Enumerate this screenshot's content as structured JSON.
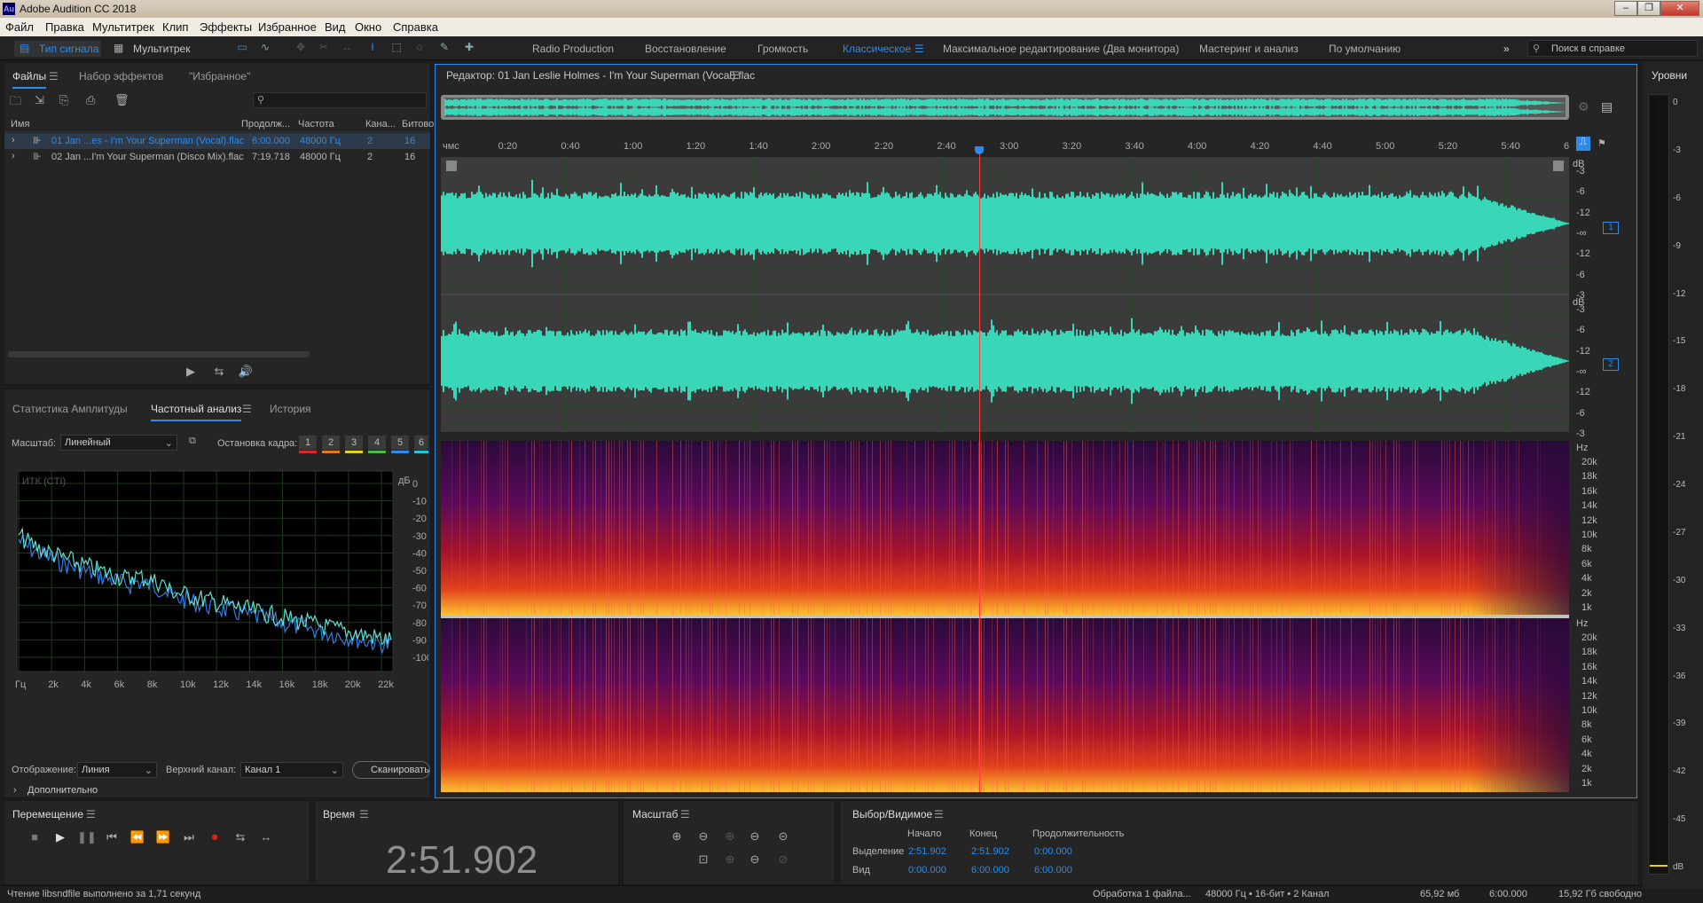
{
  "title": "Adobe Audition CC 2018",
  "app_icon": "Au",
  "window_controls": [
    "minimize-icon",
    "restore-icon",
    "close-icon"
  ],
  "menu": [
    "Файл",
    "Правка",
    "Мультитрек",
    "Клип",
    "Эффекты",
    "Избранное",
    "Вид",
    "Окно",
    "Справка"
  ],
  "views": {
    "waveform": "Тип сигнала",
    "multitrack": "Мультитрек"
  },
  "workspaces": [
    "Radio Production",
    "Восстановление",
    "Громкость",
    "Классическое",
    "Максимальное редактирование (Два монитора)",
    "Мастеринг и анализ",
    "По умолчанию"
  ],
  "active_workspace": "Классическое",
  "search_help": "Поиск в справке",
  "files_panel": {
    "tabs": [
      "Файлы",
      "Набор эффектов",
      "\"Избранное\""
    ],
    "columns": [
      "Имя",
      "Продолж...",
      "Частота",
      "Кана...",
      "Битово"
    ],
    "rows": [
      {
        "name": "01 Jan ...es - I'm Your Superman (Vocal).flac",
        "duration": "6:00.000",
        "rate": "48000 Гц",
        "channels": "2",
        "bits": "16"
      },
      {
        "name": "02 Jan ...I'm Your Superman (Disco Mix).flac",
        "duration": "7:19.718",
        "rate": "48000 Гц",
        "channels": "2",
        "bits": "16"
      }
    ]
  },
  "analysis_panel": {
    "tabs": [
      "Статистика Амплитуды",
      "Частотный анализ",
      "История"
    ],
    "scale_label": "Масштаб:",
    "scale_value": "Линейный",
    "freeze_label": "Остановка кадра:",
    "freeze_slots": [
      "1",
      "2",
      "3",
      "4",
      "5",
      "6"
    ],
    "freeze_colors": [
      "#d9262b",
      "#e8761c",
      "#e6d21a",
      "#4cb948",
      "#2d8ceb",
      "#22c4d8"
    ],
    "graph_label": "ИТК (CTI)",
    "db_unit": "дБ",
    "db_ticks": [
      "0",
      "-10",
      "-20",
      "-30",
      "-40",
      "-50",
      "-60",
      "-70",
      "-80",
      "-90",
      "-100"
    ],
    "freq_ticks": [
      "Гц",
      "2k",
      "4k",
      "6k",
      "8k",
      "10k",
      "12k",
      "14k",
      "16k",
      "18k",
      "20k",
      "22k"
    ],
    "display_label": "Отображение:",
    "display_value": "Линия",
    "channel_label": "Верхний канал:",
    "channel_value": "Канал 1",
    "scan_button": "Сканировать",
    "advanced": "Дополнительно"
  },
  "editor": {
    "title": "Редактор: 01 Jan Leslie Holmes - I'm Your Superman (Vocal).flac",
    "time_unit": "чмс",
    "time_ticks": [
      "0:20",
      "0:40",
      "1:00",
      "1:20",
      "1:40",
      "2:00",
      "2:20",
      "2:40",
      "3:00",
      "3:20",
      "3:40",
      "4:00",
      "4:20",
      "4:40",
      "5:00",
      "5:20",
      "5:40",
      "6:"
    ],
    "playhead_fraction": 0.4775,
    "db_label": "dB",
    "db_ticks_top": [
      "-3",
      "-6",
      "-12",
      "-∞",
      "-12",
      "-6",
      "-3"
    ],
    "channels": [
      "1",
      "2"
    ],
    "hz_label": "Hz",
    "hz_ticks": [
      "20k",
      "18k",
      "16k",
      "14k",
      "12k",
      "10k",
      "8k",
      "6k",
      "4k",
      "2k",
      "1k"
    ],
    "waveform_color": "#3ad6b8"
  },
  "levels_panel": {
    "title": "Уровни",
    "ticks": [
      "0",
      "-3",
      "-6",
      "-9",
      "-12",
      "-15",
      "-18",
      "-21",
      "-24",
      "-27",
      "-30",
      "-33",
      "-36",
      "-39",
      "-42",
      "-45",
      "dB"
    ]
  },
  "transport": {
    "title": "Перемещение",
    "buttons": [
      "stop-icon",
      "play-icon",
      "go-to-start-icon",
      "rewind-icon",
      "fast-forward-icon",
      "go-to-end-icon",
      "record-icon",
      "loop-icon",
      "skip-selection-icon"
    ]
  },
  "time_panel": {
    "title": "Время",
    "value": "2:51.902"
  },
  "zoom_panel": {
    "title": "Масштаб"
  },
  "selection_panel": {
    "title": "Выбор/Видимое",
    "headers": [
      "Начало",
      "Конец",
      "Продолжительность"
    ],
    "rows": [
      {
        "label": "Выделение",
        "start": "2:51.902",
        "end": "2:51.902",
        "duration": "0:00.000"
      },
      {
        "label": "Вид",
        "start": "0:00.000",
        "end": "6:00.000",
        "duration": "6:00.000"
      }
    ]
  },
  "status_bar": {
    "message": "Чтение libsndfile выполнено за 1,71 секунд",
    "processing": "Обработка 1 файла...",
    "format": "48000 Гц • 16-бит • 2 Канал",
    "size": "65,92 мб",
    "duration": "6:00.000",
    "free": "15,92 Гб свободно"
  }
}
